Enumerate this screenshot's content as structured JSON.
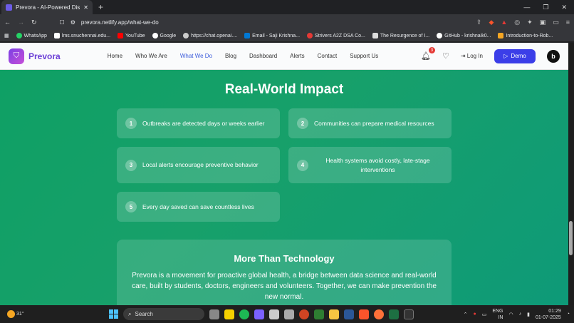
{
  "browser": {
    "tab_title": "Prevora - AI-Powered Disease Pr",
    "tab_close": "✕",
    "new_tab": "+",
    "url": "prevora.netlify.app/what-we-do",
    "window_controls": [
      "—",
      "❐",
      "✕"
    ],
    "bookmarks": [
      {
        "label": "WhatsApp",
        "color": "#25d366"
      },
      {
        "label": "lms.snuchennai.edu...",
        "color": "#ffffff"
      },
      {
        "label": "YouTube",
        "color": "#ff0000"
      },
      {
        "label": "Google",
        "color": "#ffffff"
      },
      {
        "label": "https://chat.openai....",
        "color": "#cccccc"
      },
      {
        "label": "Email - Saji Krishna...",
        "color": "#0078d4"
      },
      {
        "label": "Strivers A2Z DSA Co...",
        "color": "#e53935"
      },
      {
        "label": "The Resurgence of I...",
        "color": "#dddddd"
      },
      {
        "label": "GitHub - krishnaik0...",
        "color": "#ffffff"
      },
      {
        "label": "Introduction-to-Rob...",
        "color": "#f5a623"
      }
    ]
  },
  "site": {
    "brand": "Prevora",
    "menu": [
      "Home",
      "Who We Are",
      "What We Do",
      "Blog",
      "Dashboard",
      "Alerts",
      "Contact",
      "Support Us"
    ],
    "active_menu": "What We Do",
    "notification_count": "3",
    "login_label": "Log In",
    "demo_label": "Demo",
    "avatar_letter": "b",
    "accent": "#3b3ee8"
  },
  "impact": {
    "title": "Real-World Impact",
    "items": [
      {
        "n": "1",
        "text": "Outbreaks are detected days or weeks earlier"
      },
      {
        "n": "2",
        "text": "Communities can prepare medical resources"
      },
      {
        "n": "3",
        "text": "Local alerts encourage preventive behavior"
      },
      {
        "n": "4",
        "text": "Health systems avoid costly, late-stage interventions"
      },
      {
        "n": "5",
        "text": "Every day saved can save countless lives"
      }
    ]
  },
  "more": {
    "title": "More Than Technology",
    "body": "Prevora is a movement for proactive global health, a bridge between data science and real-world care, built by students, doctors, engineers and volunteers. Together, we can make prevention the new normal."
  },
  "taskbar": {
    "temp": "31°",
    "search": "Search",
    "lang_top": "ENG",
    "lang_bottom": "IN",
    "time": "01:29",
    "date": "01-07-2025"
  }
}
